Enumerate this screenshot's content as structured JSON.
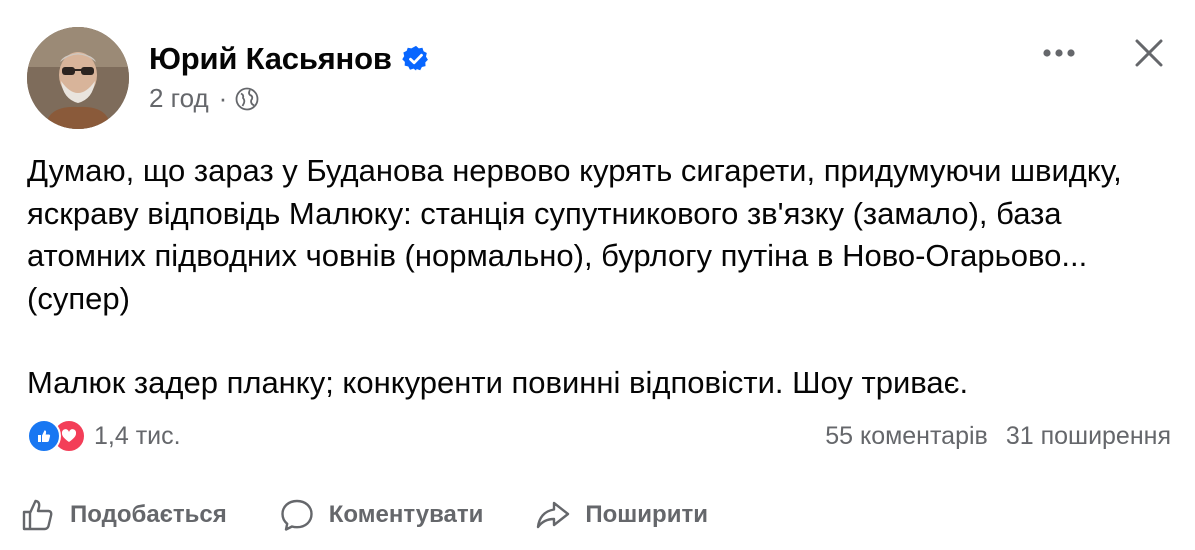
{
  "post": {
    "author": {
      "name": "Юрий Касьянов",
      "verified": true,
      "avatar_icon": "profile-photo"
    },
    "timestamp": "2 год",
    "separator": "·",
    "privacy_icon": "globe-icon",
    "menu": {
      "more_glyph": "···",
      "close_glyph": "✕"
    },
    "text": {
      "paragraph1": "Думаю, що зараз у Буданова нервово курять сигарети, придумуючи швидку, яскраву відповідь Малюку: станція супутникового зв'язку (замало), база атомних підводних човнів (нормально), бурлогу путіна в Ново-Огарьово... (супер)",
      "paragraph2": "Малюк задер планку; конкуренти повинні відповісти. Шоу триває."
    },
    "stats": {
      "reactions": [
        "like",
        "love"
      ],
      "reaction_count": "1,4 тис.",
      "comments": "55 коментарів",
      "shares": "31 поширення"
    },
    "actions": {
      "like_label": "Подобається",
      "comment_label": "Коментувати",
      "share_label": "Поширити"
    }
  },
  "colors": {
    "text": "#050505",
    "secondary": "#65676b",
    "like_blue": "#1877f2",
    "love_red": "#f33e58",
    "verified_blue": "#0866ff"
  }
}
